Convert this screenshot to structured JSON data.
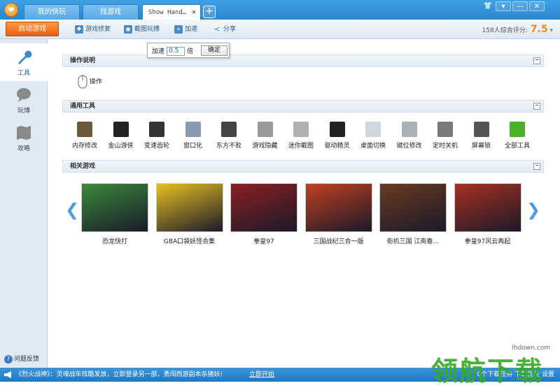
{
  "titlebar": {
    "tabs": [
      {
        "label": "我的快玩"
      },
      {
        "label": "找游戏"
      },
      {
        "label": "Show Hand…"
      }
    ],
    "add_tab": "+"
  },
  "toolbar": {
    "start_label": "启动游戏",
    "items": [
      {
        "label": "游戏修复",
        "icon": "wrench-icon"
      },
      {
        "label": "截图玩搏",
        "icon": "camera-icon"
      },
      {
        "label": "加速",
        "icon": "fast-forward-icon"
      },
      {
        "label": "分享",
        "icon": "share-icon"
      }
    ],
    "rating_text": "158人综合评分:",
    "rating_score": "7.5"
  },
  "speed_popup": {
    "prefix": "加速",
    "value": "0.5",
    "suffix": "倍",
    "confirm": "确定"
  },
  "sidebar": {
    "items": [
      {
        "label": "工具",
        "icon": "wrench-icon"
      },
      {
        "label": "玩博",
        "icon": "chat-bubble-icon"
      },
      {
        "label": "攻略",
        "icon": "map-icon"
      }
    ],
    "feedback": "问题反馈"
  },
  "sections": {
    "operation": {
      "title": "操作说明",
      "item": "操作"
    },
    "tools": {
      "title": "通用工具",
      "items": [
        {
          "label": "内存修改",
          "color": "#6b5a3a"
        },
        {
          "label": "金山游侠",
          "color": "#222222"
        },
        {
          "label": "变速齿轮",
          "color": "#333333"
        },
        {
          "label": "窗口化",
          "color": "#8a9ab0"
        },
        {
          "label": "东方不败",
          "color": "#444444"
        },
        {
          "label": "游戏隐藏",
          "color": "#9a9a9a"
        },
        {
          "label": "迷你截图",
          "color": "#b0b0b0"
        },
        {
          "label": "驱动精灵",
          "color": "#222222"
        },
        {
          "label": "桌面切换",
          "color": "#cfd6de"
        },
        {
          "label": "键位修改",
          "color": "#a8b0b8"
        },
        {
          "label": "定时关机",
          "color": "#7a7a7a"
        },
        {
          "label": "屏幕锁",
          "color": "#555555"
        },
        {
          "label": "全部工具",
          "color": "#4ab02a"
        }
      ]
    },
    "games": {
      "title": "相关游戏",
      "items": [
        {
          "label": "恐龙快打",
          "color": "#3a8a3a"
        },
        {
          "label": "GBA口袋妖怪合集",
          "color": "#e8c020"
        },
        {
          "label": "拳皇97",
          "color": "#8a2020"
        },
        {
          "label": "三国战纪三合一版",
          "color": "#c04020"
        },
        {
          "label": "街机三国 江南春…",
          "color": "#6a3a20"
        },
        {
          "label": "拳皇97风云再起",
          "color": "#a83020"
        }
      ]
    }
  },
  "statusbar": {
    "news": "《烈火战神》：灵魂战车炫酷发放，立即登录另一部，勇闯西游副本杀猪妖!",
    "link": "立即开始",
    "right": "0个下载任务  下载优先  设置"
  },
  "watermark": {
    "url": "lhdown.com",
    "text": "领航下载"
  }
}
